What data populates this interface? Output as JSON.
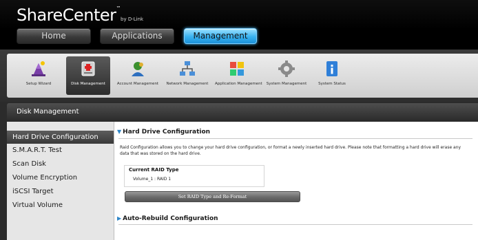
{
  "app": {
    "logo_main": "ShareCenter",
    "logo_tm": "™",
    "logo_by": "by D-Link"
  },
  "nav_tabs": [
    {
      "label": "Home"
    },
    {
      "label": "Applications"
    },
    {
      "label": "Management"
    }
  ],
  "toolbar": [
    {
      "label": "Setup Wizard",
      "icon": "wizard-icon"
    },
    {
      "label": "Disk Management",
      "icon": "disk-management-icon"
    },
    {
      "label": "Account Management",
      "icon": "account-management-icon"
    },
    {
      "label": "Network Management",
      "icon": "network-management-icon"
    },
    {
      "label": "Application Management",
      "icon": "application-management-icon"
    },
    {
      "label": "System Management",
      "icon": "system-management-icon"
    },
    {
      "label": "System Status",
      "icon": "system-status-icon"
    }
  ],
  "section_title": "Disk Management",
  "sidebar": [
    {
      "label": "Hard Drive Configuration"
    },
    {
      "label": "S.M.A.R.T. Test"
    },
    {
      "label": "Scan Disk"
    },
    {
      "label": "Volume Encryption"
    },
    {
      "label": "iSCSI Target"
    },
    {
      "label": "Virtual Volume"
    }
  ],
  "main": {
    "hd_config_title": "Hard Drive Configuration",
    "description": "Raid Configuration allows you to change your hard drive configuration, or format a newly inserted hard drive. Please note that formatting a hard drive will erase any data that was stored on the hard drive.",
    "current_raid_label": "Current RAID Type",
    "current_raid_value": "Volume_1 : RAID 1",
    "set_raid_button": "Set RAID Type and Re-Format",
    "auto_rebuild_title": "Auto-Rebuild Configuration"
  },
  "colors": {
    "accent_blue": "#38b2f0",
    "header_black": "#000000",
    "sidebar_active": "#4a4a4a"
  }
}
